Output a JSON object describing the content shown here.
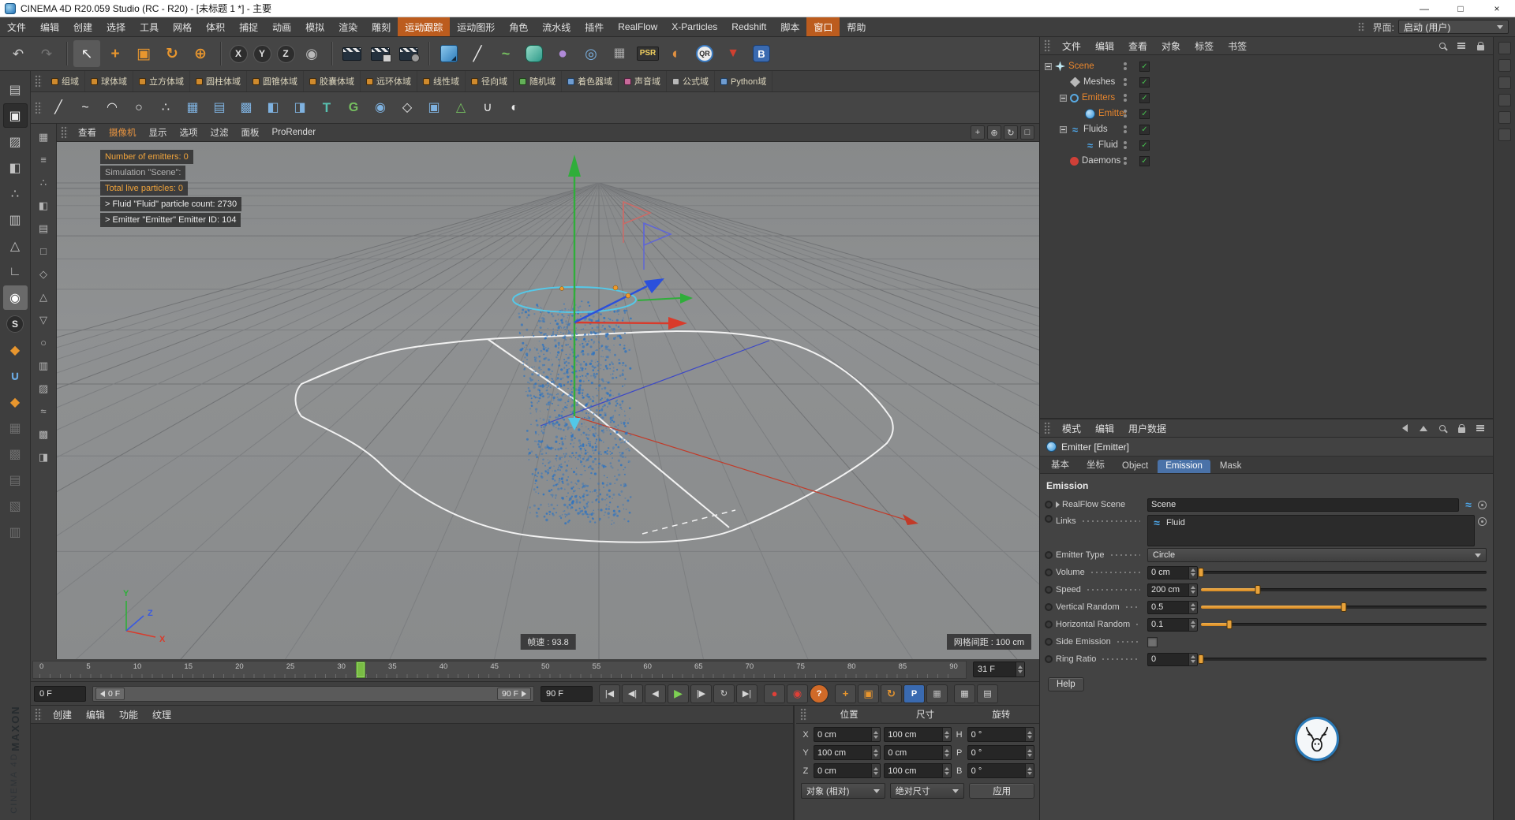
{
  "window": {
    "title": "CINEMA 4D R20.059 Studio (RC - R20) - [未标题 1 *] - 主要",
    "minimize": "—",
    "maximize": "□",
    "close": "×"
  },
  "icons": {
    "wave-icon": "≈",
    "check-icon": "✓"
  },
  "branding": {
    "line1": "MAXON",
    "line2": "CINEMA 4D"
  },
  "menubar": {
    "items": [
      {
        "label": "文件"
      },
      {
        "label": "编辑"
      },
      {
        "label": "创建"
      },
      {
        "label": "选择"
      },
      {
        "label": "工具"
      },
      {
        "label": "网格"
      },
      {
        "label": "体积"
      },
      {
        "label": "捕捉"
      },
      {
        "label": "动画"
      },
      {
        "label": "模拟"
      },
      {
        "label": "渲染"
      },
      {
        "label": "雕刻"
      },
      {
        "label": "运动跟踪",
        "cls": "hl"
      },
      {
        "label": "运动图形"
      },
      {
        "label": "角色"
      },
      {
        "label": "流水线"
      },
      {
        "label": "插件"
      },
      {
        "label": "RealFlow"
      },
      {
        "label": "X-Particles"
      },
      {
        "label": "Redshift"
      },
      {
        "label": "脚本"
      },
      {
        "label": "窗口",
        "cls": "hl"
      },
      {
        "label": "帮助"
      }
    ],
    "interface_label": "界面:",
    "interface_value": "启动 (用户)"
  },
  "toolbar": {
    "history": [
      {
        "g": "↶"
      },
      {
        "g": "↷",
        "cls": "dim"
      }
    ],
    "tools": [
      {
        "g": "↖",
        "cls": "sel"
      },
      {
        "g": "+",
        "cls": "orange"
      },
      {
        "g": "▣",
        "cls": "orange"
      },
      {
        "g": "↻",
        "cls": "orange"
      },
      {
        "g": "⊕",
        "cls": "orange"
      }
    ],
    "axes": [
      {
        "g": "X",
        "cls": "axis"
      },
      {
        "g": "Y",
        "cls": "axis"
      },
      {
        "g": "Z",
        "cls": "axis"
      },
      {
        "g": "◉",
        "cls": "globe"
      }
    ],
    "render": [
      {
        "g": "",
        "cls": "clap"
      },
      {
        "g": "",
        "cls": "clap clap2"
      },
      {
        "g": "",
        "cls": "clap clap3"
      }
    ],
    "objects": [
      {
        "g": "",
        "cls": "cube"
      },
      {
        "g": "╱",
        "cls": "pen"
      },
      {
        "g": "~",
        "cls": "green"
      },
      {
        "g": "",
        "cls": "subdiv"
      },
      {
        "g": "●",
        "cls": "purple"
      },
      {
        "g": "◎",
        "cls": "blue"
      },
      {
        "g": "▦",
        "cls": "gray"
      },
      {
        "g": "PSR",
        "cls": "psr"
      },
      {
        "g": "◐",
        "cls": "sky"
      },
      {
        "g": "QR",
        "cls": "qr"
      },
      {
        "g": "▼",
        "cls": "red"
      },
      {
        "g": "B",
        "cls": "bp"
      }
    ],
    "modeling": [
      {
        "g": "╱",
        "cls": "w"
      },
      {
        "g": "~",
        "cls": "w"
      },
      {
        "g": "◠",
        "cls": "w"
      },
      {
        "g": "○",
        "cls": "w"
      },
      {
        "g": "∴",
        "cls": "w"
      },
      {
        "g": "▦",
        "cls": "b"
      },
      {
        "g": "▤",
        "cls": "b"
      },
      {
        "g": "▩",
        "cls": "b"
      },
      {
        "g": "◧",
        "cls": "b"
      },
      {
        "g": "◨",
        "cls": "b"
      },
      {
        "g": "T",
        "cls": "t"
      },
      {
        "g": "G",
        "cls": "g"
      },
      {
        "g": "◉",
        "cls": "b"
      },
      {
        "g": "◇",
        "cls": "w"
      },
      {
        "g": "▣",
        "cls": "b"
      },
      {
        "g": "△",
        "cls": "g"
      },
      {
        "g": "∪",
        "cls": "w"
      },
      {
        "g": "◐",
        "cls": "w"
      }
    ]
  },
  "fields_palette": [
    {
      "label": "组域"
    },
    {
      "label": "球体域"
    },
    {
      "label": "立方体域"
    },
    {
      "label": "圆柱体域"
    },
    {
      "label": "圆锥体域"
    },
    {
      "label": "胶囊体域"
    },
    {
      "label": "远环体域"
    },
    {
      "label": "线性域"
    },
    {
      "label": "径向域"
    },
    {
      "label": "随机域",
      "cls": "f-green"
    },
    {
      "label": "着色器域",
      "cls": "f-blue"
    },
    {
      "label": "声音域",
      "cls": "f-pink"
    },
    {
      "label": "公式域",
      "cls": "f-gray"
    },
    {
      "label": "Python域",
      "cls": "f-blue"
    }
  ],
  "left_palette": [
    {
      "g": "▤"
    },
    {
      "g": "▣",
      "cls": "active"
    },
    {
      "g": "▨"
    },
    {
      "g": "◧"
    },
    {
      "g": "∴"
    },
    {
      "g": "▥"
    },
    {
      "g": "△"
    },
    {
      "g": "∟"
    },
    {
      "g": "◉",
      "cls": "on"
    },
    {
      "g": "S",
      "cls": "dark"
    },
    {
      "g": "◆",
      "cls": "orange"
    },
    {
      "g": "∪",
      "cls": "blue"
    },
    {
      "g": "◆",
      "cls": "orange"
    },
    {
      "g": "▦",
      "cls": "dim"
    },
    {
      "g": "▩",
      "cls": "dim"
    },
    {
      "g": "▤",
      "cls": "dim"
    },
    {
      "g": "▧",
      "cls": "dim"
    },
    {
      "g": "▥",
      "cls": "dim"
    }
  ],
  "palette2": [
    {
      "g": "▦"
    },
    {
      "g": "≡"
    },
    {
      "g": "∴"
    },
    {
      "g": "◧"
    },
    {
      "g": "▤"
    },
    {
      "g": "□"
    },
    {
      "g": "◇"
    },
    {
      "g": "△"
    },
    {
      "g": "▽"
    },
    {
      "g": "○"
    },
    {
      "g": "▥"
    },
    {
      "g": "▨"
    },
    {
      "g": "≈"
    },
    {
      "g": "▩"
    },
    {
      "g": "◨"
    }
  ],
  "viewport": {
    "menus": [
      {
        "label": "查看"
      },
      {
        "label": "摄像机",
        "cls": "cam"
      },
      {
        "label": "显示"
      },
      {
        "label": "选项"
      },
      {
        "label": "过滤"
      },
      {
        "label": "面板"
      },
      {
        "label": "ProRender"
      }
    ],
    "nav": [
      {
        "g": "+"
      },
      {
        "g": "⊕"
      },
      {
        "g": "↻"
      },
      {
        "g": "□"
      }
    ],
    "hud": [
      {
        "text": "Number of emitters: 0",
        "cls": "hud-orange"
      },
      {
        "text": "Simulation \"Scene\":",
        "cls": "hud-gray"
      },
      {
        "text": "Total live particles: 0",
        "cls": "hud-orange"
      },
      {
        "text": "> Fluid \"Fluid\" particle count: 2730",
        "cls": "hud-white"
      },
      {
        "text": "> Emitter \"Emitter\" Emitter ID: 104",
        "cls": "hud-white"
      }
    ],
    "fps": "帧速 : 93.8",
    "grid": "网格间距 : 100 cm",
    "axis": {
      "x": "X",
      "y": "Y",
      "z": "Z"
    }
  },
  "timeline": {
    "ticks": [
      "0",
      "5",
      "10",
      "15",
      "20",
      "25",
      "30",
      "35",
      "40",
      "45",
      "50",
      "55",
      "60",
      "65",
      "70",
      "75",
      "80",
      "85",
      "90"
    ],
    "frac": 0.344,
    "current": "31 F",
    "start": "0 F",
    "end": "90 F",
    "range_left": "0 F",
    "range_right": "90 F"
  },
  "transport": {
    "buttons": [
      {
        "g": "|◀"
      },
      {
        "g": "◀|"
      },
      {
        "g": "◀"
      },
      {
        "g": "▶",
        "cls": "play"
      },
      {
        "g": "|▶"
      },
      {
        "g": "↻"
      },
      {
        "g": "▶|"
      }
    ],
    "records": [
      {
        "g": "●",
        "cls": "rec"
      },
      {
        "g": "◉",
        "cls": "rec"
      },
      {
        "g": "?",
        "cls": "quest"
      }
    ],
    "keys": [
      {
        "g": "+",
        "cls": "ko"
      },
      {
        "g": "▣",
        "cls": "ko"
      },
      {
        "g": "↻",
        "cls": "ko"
      },
      {
        "g": "P",
        "cls": "kb"
      },
      {
        "g": "▦",
        "cls": "kg"
      }
    ],
    "end_icons": [
      {
        "g": "▦"
      },
      {
        "g": "▤"
      }
    ]
  },
  "material": {
    "menus": [
      "创建",
      "编辑",
      "功能",
      "纹理"
    ]
  },
  "coords": {
    "headers": [
      "位置",
      "尺寸",
      "旋转"
    ],
    "rows": [
      {
        "a": "X",
        "pos": "0 cm",
        "size": "100 cm",
        "rl": "H",
        "rot": "0 °"
      },
      {
        "a": "Y",
        "pos": "100 cm",
        "size": "0 cm",
        "rl": "P",
        "rot": "0 °"
      },
      {
        "a": "Z",
        "pos": "0 cm",
        "size": "100 cm",
        "rl": "B",
        "rot": "0 °"
      }
    ],
    "mode1": "对象 (相对)",
    "mode2": "绝对尺寸",
    "apply": "应用"
  },
  "om": {
    "menus": [
      "文件",
      "编辑",
      "查看",
      "对象",
      "标签",
      "书签"
    ],
    "tree": [
      {
        "label": "Scene",
        "lvl": "lvl0",
        "txt": "sel",
        "icon": "ic-scene",
        "exp": "show"
      },
      {
        "label": "Meshes",
        "lvl": "lvl1",
        "txt": "norm",
        "icon": "ic-mesh",
        "exp": "hide"
      },
      {
        "label": "Emitters",
        "lvl": "lvl1",
        "txt": "sel",
        "icon": "ic-emitters",
        "exp": "show"
      },
      {
        "label": "Emitter",
        "lvl": "lvl2",
        "txt": "sel",
        "icon": "ic-emitter",
        "exp": "hide"
      },
      {
        "label": "Fluids",
        "lvl": "lvl1",
        "txt": "norm",
        "icon": "ic-fluids",
        "exp": "show"
      },
      {
        "label": "Fluid",
        "lvl": "lvl2",
        "txt": "norm",
        "icon": "ic-fluid",
        "exp": "hide"
      },
      {
        "label": "Daemons",
        "lvl": "lvl1",
        "txt": "norm",
        "icon": "ic-daemon",
        "exp": "hide"
      }
    ]
  },
  "am": {
    "menus": [
      "模式",
      "编辑",
      "用户数据"
    ],
    "object_title": "Emitter [Emitter]",
    "tabs": [
      {
        "label": "基本"
      },
      {
        "label": "坐标"
      },
      {
        "label": "Object"
      },
      {
        "label": "Emission",
        "cls": "active"
      },
      {
        "label": "Mask"
      }
    ],
    "section": "Emission",
    "realflow_scene": {
      "label": "RealFlow Scene",
      "value": "Scene"
    },
    "links": {
      "label": "Links",
      "item": "Fluid"
    },
    "emitter_type": {
      "label": "Emitter Type",
      "value": "Circle"
    },
    "volume": {
      "label": "Volume",
      "value": "0 cm",
      "fill": 0
    },
    "speed": {
      "label": "Speed",
      "value": "200 cm",
      "fill": 0.2
    },
    "vertical_random": {
      "label": "Vertical Random",
      "value": "0.5",
      "fill": 0.5
    },
    "horizontal_random": {
      "label": "Horizontal Random",
      "value": "0.1",
      "fill": 0.1
    },
    "side_emission": {
      "label": "Side Emission"
    },
    "ring_ratio": {
      "label": "Ring Ratio",
      "value": "0",
      "fill": 0
    },
    "help": "Help"
  }
}
